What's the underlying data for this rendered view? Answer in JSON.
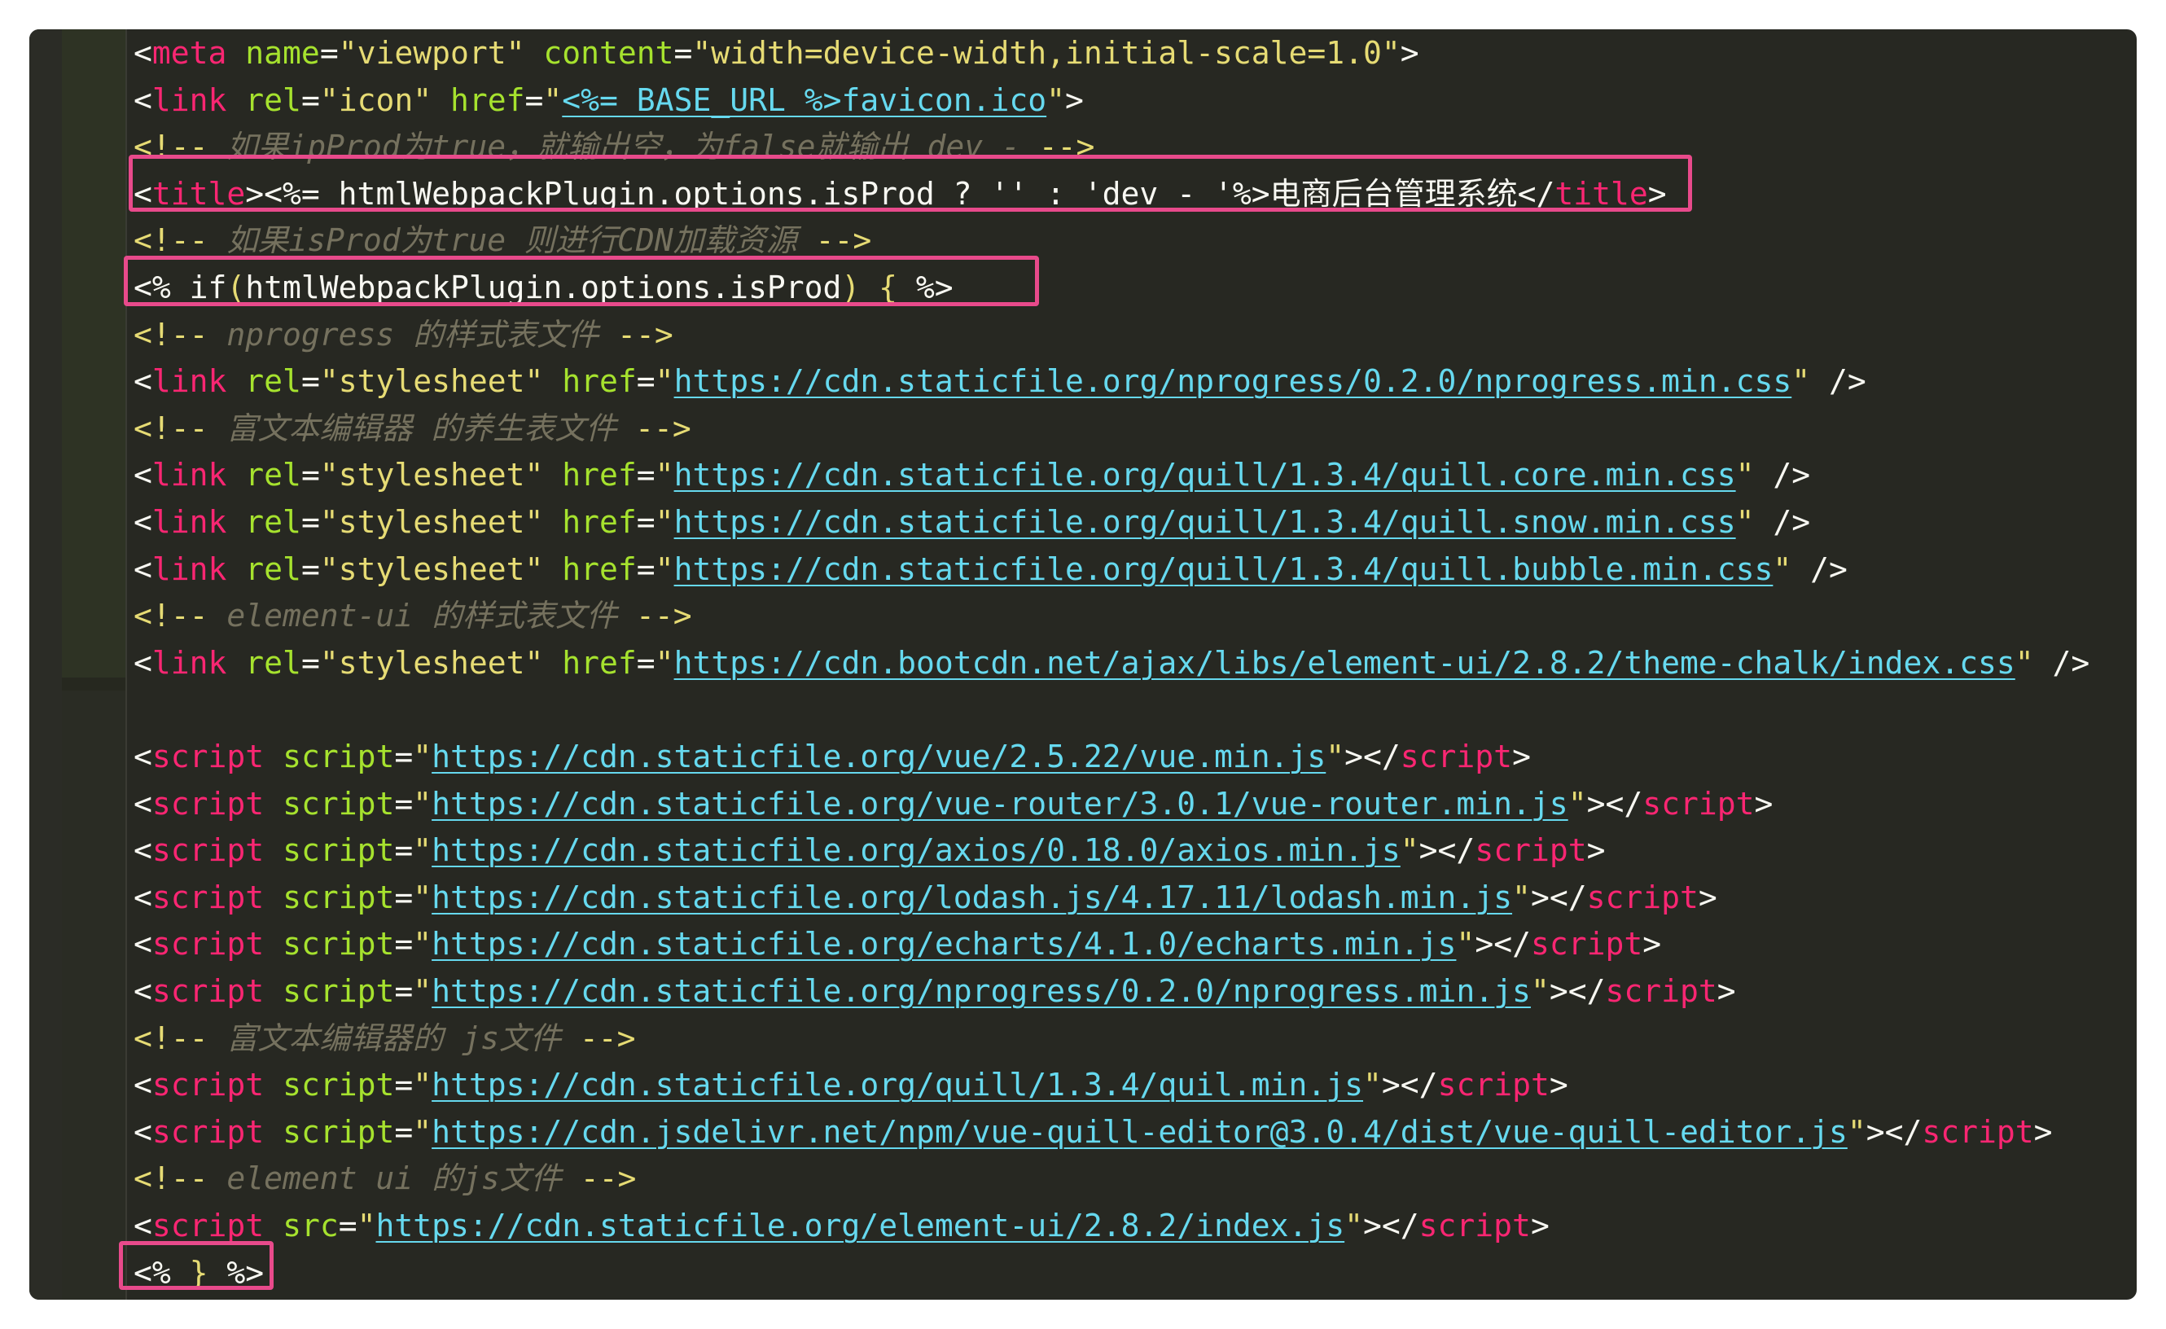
{
  "editor": {
    "lines": [
      {
        "kind": "tag",
        "parts": [
          [
            "p",
            "<"
          ],
          [
            "t",
            "meta"
          ],
          [
            "p",
            " "
          ],
          [
            "a",
            "name"
          ],
          [
            "p",
            "="
          ],
          [
            "s",
            "\"viewport\""
          ],
          [
            "p",
            " "
          ],
          [
            "a",
            "content"
          ],
          [
            "p",
            "="
          ],
          [
            "s",
            "\"width=device-width,initial-scale=1.0\""
          ],
          [
            "p",
            ">"
          ]
        ]
      },
      {
        "kind": "tag",
        "parts": [
          [
            "p",
            "<"
          ],
          [
            "t",
            "link"
          ],
          [
            "p",
            " "
          ],
          [
            "a",
            "rel"
          ],
          [
            "p",
            "="
          ],
          [
            "s",
            "\"icon\""
          ],
          [
            "p",
            " "
          ],
          [
            "a",
            "href"
          ],
          [
            "p",
            "="
          ],
          [
            "s",
            "\""
          ],
          [
            "u",
            "<%= BASE_URL %>favicon.ico"
          ],
          [
            "s",
            "\""
          ],
          [
            "p",
            ">"
          ]
        ]
      },
      {
        "kind": "comment",
        "parts": [
          [
            "y",
            "<!--"
          ],
          [
            "c",
            " 如果ipProd为true，就输出空，为false就输出 dev - "
          ],
          [
            "y",
            "-->"
          ]
        ]
      },
      {
        "kind": "tag",
        "parts": [
          [
            "p",
            "<"
          ],
          [
            "t",
            "title"
          ],
          [
            "p",
            ">"
          ],
          [
            "p",
            "<%= htmlWebpackPlugin.options.isProd ? '' : 'dev - '%>电商后台管理系统"
          ],
          [
            "p",
            "</"
          ],
          [
            "t",
            "title"
          ],
          [
            "p",
            ">"
          ]
        ]
      },
      {
        "kind": "comment",
        "parts": [
          [
            "y",
            "<!--"
          ],
          [
            "c",
            " 如果isProd为true 则进行CDN加载资源 "
          ],
          [
            "y",
            "-->"
          ]
        ]
      },
      {
        "kind": "ejs",
        "parts": [
          [
            "p",
            "<% if"
          ],
          [
            "y",
            "("
          ],
          [
            "p",
            "htmlWebpackPlugin.options.isProd"
          ],
          [
            "y",
            ")"
          ],
          [
            "p",
            " "
          ],
          [
            "y",
            "{"
          ],
          [
            "p",
            " %>"
          ]
        ]
      },
      {
        "kind": "comment",
        "parts": [
          [
            "y",
            "<!--"
          ],
          [
            "c",
            " nprogress 的样式表文件 "
          ],
          [
            "y",
            "-->"
          ]
        ]
      },
      {
        "kind": "tag",
        "parts": [
          [
            "p",
            "<"
          ],
          [
            "t",
            "link"
          ],
          [
            "p",
            " "
          ],
          [
            "a",
            "rel"
          ],
          [
            "p",
            "="
          ],
          [
            "s",
            "\"stylesheet\""
          ],
          [
            "p",
            " "
          ],
          [
            "a",
            "href"
          ],
          [
            "p",
            "="
          ],
          [
            "s",
            "\""
          ],
          [
            "u",
            "https://cdn.staticfile.org/nprogress/0.2.0/nprogress.min.css"
          ],
          [
            "s",
            "\""
          ],
          [
            "p",
            " />"
          ]
        ]
      },
      {
        "kind": "comment",
        "parts": [
          [
            "y",
            "<!--"
          ],
          [
            "c",
            " 富文本编辑器 的养生表文件 "
          ],
          [
            "y",
            "-->"
          ]
        ]
      },
      {
        "kind": "tag",
        "parts": [
          [
            "p",
            "<"
          ],
          [
            "t",
            "link"
          ],
          [
            "p",
            " "
          ],
          [
            "a",
            "rel"
          ],
          [
            "p",
            "="
          ],
          [
            "s",
            "\"stylesheet\""
          ],
          [
            "p",
            " "
          ],
          [
            "a",
            "href"
          ],
          [
            "p",
            "="
          ],
          [
            "s",
            "\""
          ],
          [
            "u",
            "https://cdn.staticfile.org/quill/1.3.4/quill.core.min.css"
          ],
          [
            "s",
            "\""
          ],
          [
            "p",
            " />"
          ]
        ]
      },
      {
        "kind": "tag",
        "parts": [
          [
            "p",
            "<"
          ],
          [
            "t",
            "link"
          ],
          [
            "p",
            " "
          ],
          [
            "a",
            "rel"
          ],
          [
            "p",
            "="
          ],
          [
            "s",
            "\"stylesheet\""
          ],
          [
            "p",
            " "
          ],
          [
            "a",
            "href"
          ],
          [
            "p",
            "="
          ],
          [
            "s",
            "\""
          ],
          [
            "u",
            "https://cdn.staticfile.org/quill/1.3.4/quill.snow.min.css"
          ],
          [
            "s",
            "\""
          ],
          [
            "p",
            " />"
          ]
        ]
      },
      {
        "kind": "tag",
        "parts": [
          [
            "p",
            "<"
          ],
          [
            "t",
            "link"
          ],
          [
            "p",
            " "
          ],
          [
            "a",
            "rel"
          ],
          [
            "p",
            "="
          ],
          [
            "s",
            "\"stylesheet\""
          ],
          [
            "p",
            " "
          ],
          [
            "a",
            "href"
          ],
          [
            "p",
            "="
          ],
          [
            "s",
            "\""
          ],
          [
            "u",
            "https://cdn.staticfile.org/quill/1.3.4/quill.bubble.min.css"
          ],
          [
            "s",
            "\""
          ],
          [
            "p",
            " />"
          ]
        ]
      },
      {
        "kind": "comment",
        "parts": [
          [
            "y",
            "<!--"
          ],
          [
            "c",
            " element-ui 的样式表文件 "
          ],
          [
            "y",
            "-->"
          ]
        ]
      },
      {
        "kind": "tag",
        "parts": [
          [
            "p",
            "<"
          ],
          [
            "t",
            "link"
          ],
          [
            "p",
            " "
          ],
          [
            "a",
            "rel"
          ],
          [
            "p",
            "="
          ],
          [
            "s",
            "\"stylesheet\""
          ],
          [
            "p",
            " "
          ],
          [
            "a",
            "href"
          ],
          [
            "p",
            "="
          ],
          [
            "s",
            "\""
          ],
          [
            "u",
            "https://cdn.bootcdn.net/ajax/libs/element-ui/2.8.2/theme-chalk/index.css"
          ],
          [
            "s",
            "\""
          ],
          [
            "p",
            " />"
          ]
        ]
      },
      {
        "kind": "blank",
        "parts": []
      },
      {
        "kind": "tag",
        "parts": [
          [
            "p",
            "<"
          ],
          [
            "t",
            "script"
          ],
          [
            "p",
            " "
          ],
          [
            "a",
            "script"
          ],
          [
            "p",
            "="
          ],
          [
            "s",
            "\""
          ],
          [
            "u",
            "https://cdn.staticfile.org/vue/2.5.22/vue.min.js"
          ],
          [
            "s",
            "\""
          ],
          [
            "p",
            "></"
          ],
          [
            "t",
            "script"
          ],
          [
            "p",
            ">"
          ]
        ]
      },
      {
        "kind": "tag",
        "parts": [
          [
            "p",
            "<"
          ],
          [
            "t",
            "script"
          ],
          [
            "p",
            " "
          ],
          [
            "a",
            "script"
          ],
          [
            "p",
            "="
          ],
          [
            "s",
            "\""
          ],
          [
            "u",
            "https://cdn.staticfile.org/vue-router/3.0.1/vue-router.min.js"
          ],
          [
            "s",
            "\""
          ],
          [
            "p",
            "></"
          ],
          [
            "t",
            "script"
          ],
          [
            "p",
            ">"
          ]
        ]
      },
      {
        "kind": "tag",
        "parts": [
          [
            "p",
            "<"
          ],
          [
            "t",
            "script"
          ],
          [
            "p",
            " "
          ],
          [
            "a",
            "script"
          ],
          [
            "p",
            "="
          ],
          [
            "s",
            "\""
          ],
          [
            "u",
            "https://cdn.staticfile.org/axios/0.18.0/axios.min.js"
          ],
          [
            "s",
            "\""
          ],
          [
            "p",
            "></"
          ],
          [
            "t",
            "script"
          ],
          [
            "p",
            ">"
          ]
        ]
      },
      {
        "kind": "tag",
        "parts": [
          [
            "p",
            "<"
          ],
          [
            "t",
            "script"
          ],
          [
            "p",
            " "
          ],
          [
            "a",
            "script"
          ],
          [
            "p",
            "="
          ],
          [
            "s",
            "\""
          ],
          [
            "u",
            "https://cdn.staticfile.org/lodash.js/4.17.11/lodash.min.js"
          ],
          [
            "s",
            "\""
          ],
          [
            "p",
            "></"
          ],
          [
            "t",
            "script"
          ],
          [
            "p",
            ">"
          ]
        ]
      },
      {
        "kind": "tag",
        "parts": [
          [
            "p",
            "<"
          ],
          [
            "t",
            "script"
          ],
          [
            "p",
            " "
          ],
          [
            "a",
            "script"
          ],
          [
            "p",
            "="
          ],
          [
            "s",
            "\""
          ],
          [
            "u",
            "https://cdn.staticfile.org/echarts/4.1.0/echarts.min.js"
          ],
          [
            "s",
            "\""
          ],
          [
            "p",
            "></"
          ],
          [
            "t",
            "script"
          ],
          [
            "p",
            ">"
          ]
        ]
      },
      {
        "kind": "tag",
        "parts": [
          [
            "p",
            "<"
          ],
          [
            "t",
            "script"
          ],
          [
            "p",
            " "
          ],
          [
            "a",
            "script"
          ],
          [
            "p",
            "="
          ],
          [
            "s",
            "\""
          ],
          [
            "u",
            "https://cdn.staticfile.org/nprogress/0.2.0/nprogress.min.js"
          ],
          [
            "s",
            "\""
          ],
          [
            "p",
            "></"
          ],
          [
            "t",
            "script"
          ],
          [
            "p",
            ">"
          ]
        ]
      },
      {
        "kind": "comment",
        "parts": [
          [
            "y",
            "<!--"
          ],
          [
            "c",
            " 富文本编辑器的 js文件 "
          ],
          [
            "y",
            "-->"
          ]
        ]
      },
      {
        "kind": "tag",
        "parts": [
          [
            "p",
            "<"
          ],
          [
            "t",
            "script"
          ],
          [
            "p",
            " "
          ],
          [
            "a",
            "script"
          ],
          [
            "p",
            "="
          ],
          [
            "s",
            "\""
          ],
          [
            "u",
            "https://cdn.staticfile.org/quill/1.3.4/quil.min.js"
          ],
          [
            "s",
            "\""
          ],
          [
            "p",
            "></"
          ],
          [
            "t",
            "script"
          ],
          [
            "p",
            ">"
          ]
        ]
      },
      {
        "kind": "tag",
        "parts": [
          [
            "p",
            "<"
          ],
          [
            "t",
            "script"
          ],
          [
            "p",
            " "
          ],
          [
            "a",
            "script"
          ],
          [
            "p",
            "="
          ],
          [
            "s",
            "\""
          ],
          [
            "u",
            "https://cdn.jsdelivr.net/npm/vue-quill-editor@3.0.4/dist/vue-quill-editor.js"
          ],
          [
            "s",
            "\""
          ],
          [
            "p",
            "></"
          ],
          [
            "t",
            "script"
          ],
          [
            "p",
            ">"
          ]
        ]
      },
      {
        "kind": "comment",
        "parts": [
          [
            "y",
            "<!--"
          ],
          [
            "c",
            " element ui 的js文件 "
          ],
          [
            "y",
            "-->"
          ]
        ]
      },
      {
        "kind": "tag",
        "parts": [
          [
            "p",
            "<"
          ],
          [
            "t",
            "script"
          ],
          [
            "p",
            " "
          ],
          [
            "a",
            "src"
          ],
          [
            "p",
            "="
          ],
          [
            "s",
            "\""
          ],
          [
            "u",
            "https://cdn.staticfile.org/element-ui/2.8.2/index.js"
          ],
          [
            "s",
            "\""
          ],
          [
            "p",
            "></"
          ],
          [
            "t",
            "script"
          ],
          [
            "p",
            ">"
          ]
        ]
      },
      {
        "kind": "ejs",
        "parts": [
          [
            "p",
            "<% "
          ],
          [
            "y",
            "}"
          ],
          [
            "p",
            " %>"
          ]
        ]
      }
    ]
  }
}
